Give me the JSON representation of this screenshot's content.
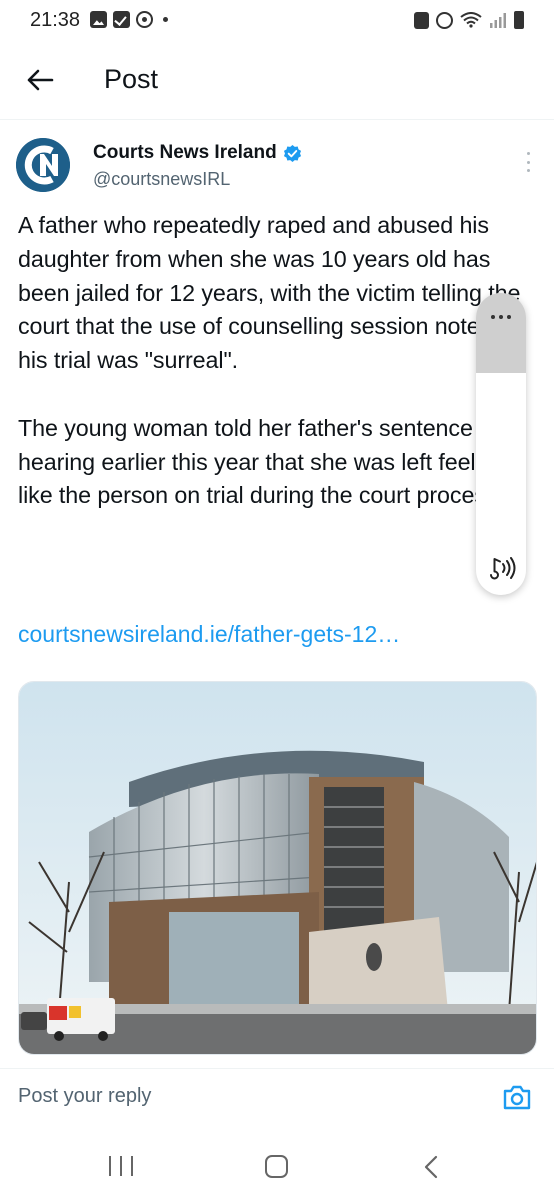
{
  "status_bar": {
    "time": "21:38"
  },
  "header": {
    "title": "Post"
  },
  "post": {
    "author": {
      "name": "Courts News Ireland",
      "handle": "@courtsnewsIRL",
      "verified": true
    },
    "text": "A father who repeatedly raped and abused his daughter from when she was 10 years old has been jailed for 12 years, with the victim telling the court that the use of counselling session notes at his trial was \"surreal\".\n\nThe young woman told her father's sentence hearing earlier this year that she was left feeling like the person on trial during the court process.",
    "link": "courtsnewsireland.ie/father-gets-12…"
  },
  "reply": {
    "placeholder": "Post your reply"
  },
  "colors": {
    "link": "#1d9bf0",
    "verified": "#1d9bf0",
    "secondary_text": "#536471",
    "avatar_bg": "#1e5f8a"
  },
  "icons": {
    "back": "arrow-left-icon",
    "more": "more-vertical-icon",
    "camera": "camera-icon",
    "sound": "sound-wave-icon"
  }
}
